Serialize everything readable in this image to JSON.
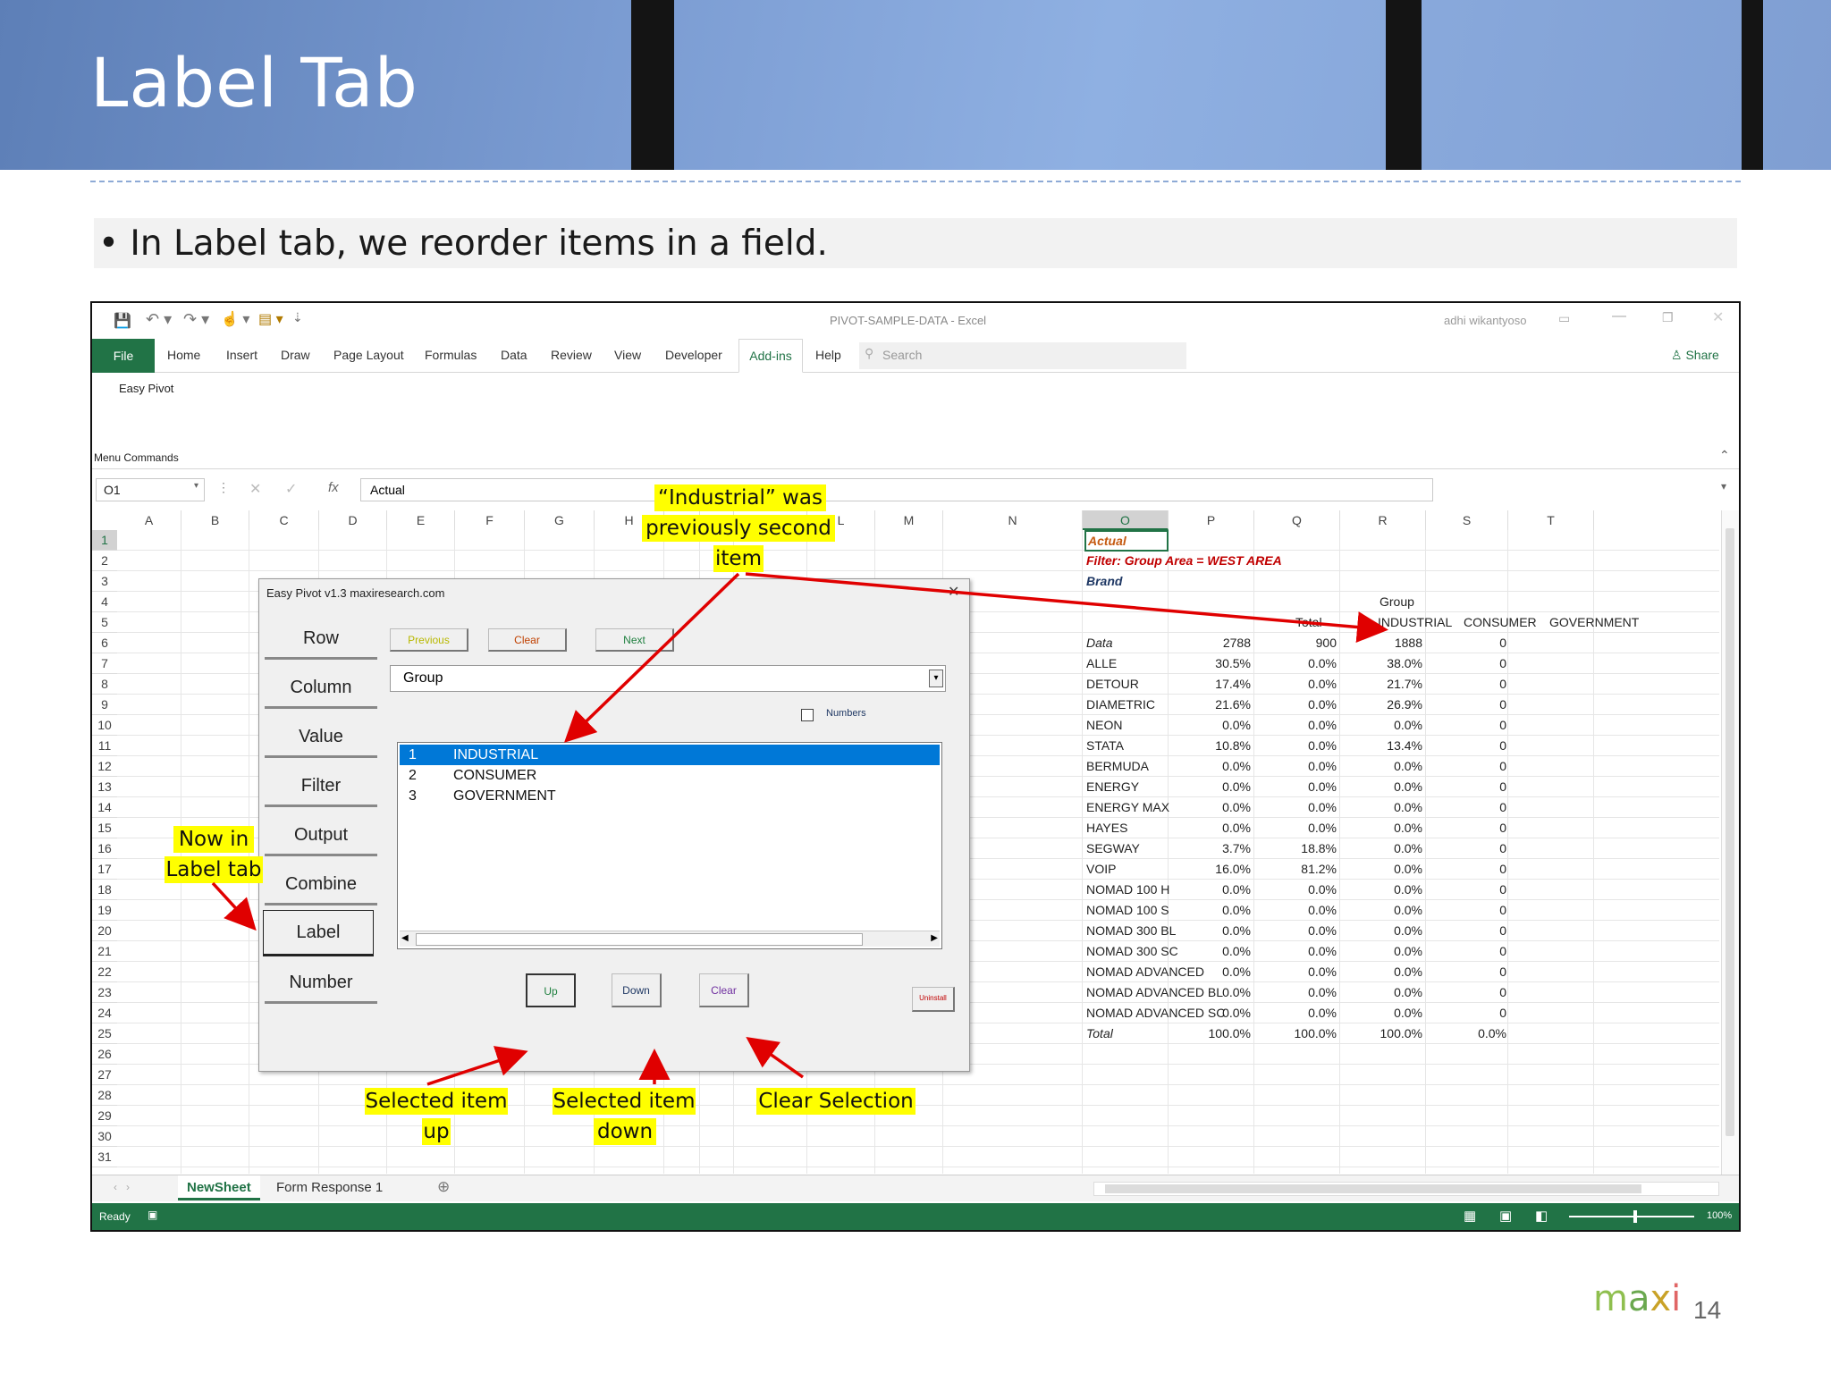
{
  "slide": {
    "title": "Label Tab",
    "bullet": "In Label tab, we reorder items in a field.",
    "page_number": "14",
    "logo_text": "maxi"
  },
  "excel": {
    "window_title": "PIVOT-SAMPLE-DATA  -  Excel",
    "user": "adhi wikantyoso",
    "tabs": [
      "Home",
      "Insert",
      "Draw",
      "Page Layout",
      "Formulas",
      "Data",
      "Review",
      "View",
      "Developer"
    ],
    "file_tab": "File",
    "active_tab": "Add-ins",
    "help_tab": "Help",
    "search_placeholder": "Search",
    "share_label": "Share",
    "ribbon_button": "Easy Pivot",
    "ribbon_group": "Menu Commands",
    "name_box": "O1",
    "formula": "Actual",
    "columns": [
      "A",
      "B",
      "C",
      "D",
      "E",
      "F",
      "G",
      "H",
      "I",
      "J",
      "K",
      "L",
      "M",
      "N",
      "O",
      "P",
      "Q",
      "R",
      "S",
      "T"
    ],
    "rows": [
      "1",
      "2",
      "3",
      "4",
      "5",
      "6",
      "7",
      "8",
      "9",
      "10",
      "11",
      "12",
      "13",
      "14",
      "15",
      "16",
      "17",
      "18",
      "19",
      "20",
      "21",
      "22",
      "23",
      "24",
      "25",
      "26",
      "27",
      "28",
      "29",
      "30",
      "31"
    ],
    "o1": "Actual",
    "o2_label": "Filter:  Group Area = ",
    "o2_value": "WEST AREA",
    "o3": "Brand",
    "group_header": "Group",
    "total_header": "Total",
    "group_columns": [
      "INDUSTRIAL",
      "CONSUMER",
      "GOVERNMENT"
    ],
    "table": [
      {
        "name": "Data",
        "p": "2788",
        "q": "900",
        "r": "1888",
        "s": "0"
      },
      {
        "name": "ALLE",
        "p": "30.5%",
        "q": "0.0%",
        "r": "38.0%",
        "s": "0"
      },
      {
        "name": "DETOUR",
        "p": "17.4%",
        "q": "0.0%",
        "r": "21.7%",
        "s": "0"
      },
      {
        "name": "DIAMETRIC",
        "p": "21.6%",
        "q": "0.0%",
        "r": "26.9%",
        "s": "0"
      },
      {
        "name": "NEON",
        "p": "0.0%",
        "q": "0.0%",
        "r": "0.0%",
        "s": "0"
      },
      {
        "name": "STATA",
        "p": "10.8%",
        "q": "0.0%",
        "r": "13.4%",
        "s": "0"
      },
      {
        "name": "BERMUDA",
        "p": "0.0%",
        "q": "0.0%",
        "r": "0.0%",
        "s": "0"
      },
      {
        "name": "ENERGY",
        "p": "0.0%",
        "q": "0.0%",
        "r": "0.0%",
        "s": "0"
      },
      {
        "name": "ENERGY MAX",
        "p": "0.0%",
        "q": "0.0%",
        "r": "0.0%",
        "s": "0"
      },
      {
        "name": "HAYES",
        "p": "0.0%",
        "q": "0.0%",
        "r": "0.0%",
        "s": "0"
      },
      {
        "name": "SEGWAY",
        "p": "3.7%",
        "q": "18.8%",
        "r": "0.0%",
        "s": "0"
      },
      {
        "name": "VOIP",
        "p": "16.0%",
        "q": "81.2%",
        "r": "0.0%",
        "s": "0"
      },
      {
        "name": "NOMAD 100 H",
        "p": "0.0%",
        "q": "0.0%",
        "r": "0.0%",
        "s": "0"
      },
      {
        "name": "NOMAD 100 S",
        "p": "0.0%",
        "q": "0.0%",
        "r": "0.0%",
        "s": "0"
      },
      {
        "name": "NOMAD 300 BL",
        "p": "0.0%",
        "q": "0.0%",
        "r": "0.0%",
        "s": "0"
      },
      {
        "name": "NOMAD 300 SC",
        "p": "0.0%",
        "q": "0.0%",
        "r": "0.0%",
        "s": "0"
      },
      {
        "name": "NOMAD ADVANCED",
        "p": "0.0%",
        "q": "0.0%",
        "r": "0.0%",
        "s": "0"
      },
      {
        "name": "NOMAD ADVANCED BL",
        "p": "0.0%",
        "q": "0.0%",
        "r": "0.0%",
        "s": "0"
      },
      {
        "name": "NOMAD ADVANCED SC",
        "p": "0.0%",
        "q": "0.0%",
        "r": "0.0%",
        "s": "0"
      },
      {
        "name": "Total",
        "p": "100.0%",
        "q": "100.0%",
        "r": "100.0%",
        "s": "0.0%"
      }
    ],
    "sheet_tabs": [
      "NewSheet",
      "Form Response 1"
    ],
    "status": "Ready",
    "zoom": "100%"
  },
  "dialog": {
    "title": "Easy Pivot v1.3  maxiresearch.com",
    "nav": [
      "Row",
      "Column",
      "Value",
      "Filter",
      "Output",
      "Combine",
      "Label",
      "Number"
    ],
    "active_nav": "Label",
    "previous": "Previous",
    "clear": "Clear",
    "next": "Next",
    "field": "Group",
    "numbers_label": "Numbers",
    "items": [
      {
        "idx": "1",
        "label": "INDUSTRIAL"
      },
      {
        "idx": "2",
        "label": "CONSUMER"
      },
      {
        "idx": "3",
        "label": "GOVERNMENT"
      }
    ],
    "up": "Up",
    "down": "Down",
    "clear2": "Clear",
    "uninstall": "Uninstall"
  },
  "callouts": {
    "industrial_l1": "“Industrial” was",
    "industrial_l2": "previously second",
    "industrial_l3": "item",
    "label_l1": "Now in",
    "label_l2": "Label tab",
    "up_l1": "Selected item",
    "up_l2": "up",
    "down_l1": "Selected item",
    "down_l2": "down",
    "clear": "Clear Selection"
  },
  "colors": {
    "excel_green": "#217346",
    "selection_blue": "#0078d7",
    "callout_yellow": "#ffff00",
    "arrow_red": "#e00000",
    "actual_orange": "#c55a11",
    "filter_red": "#c00000",
    "nav_purple": "#1f3864"
  }
}
